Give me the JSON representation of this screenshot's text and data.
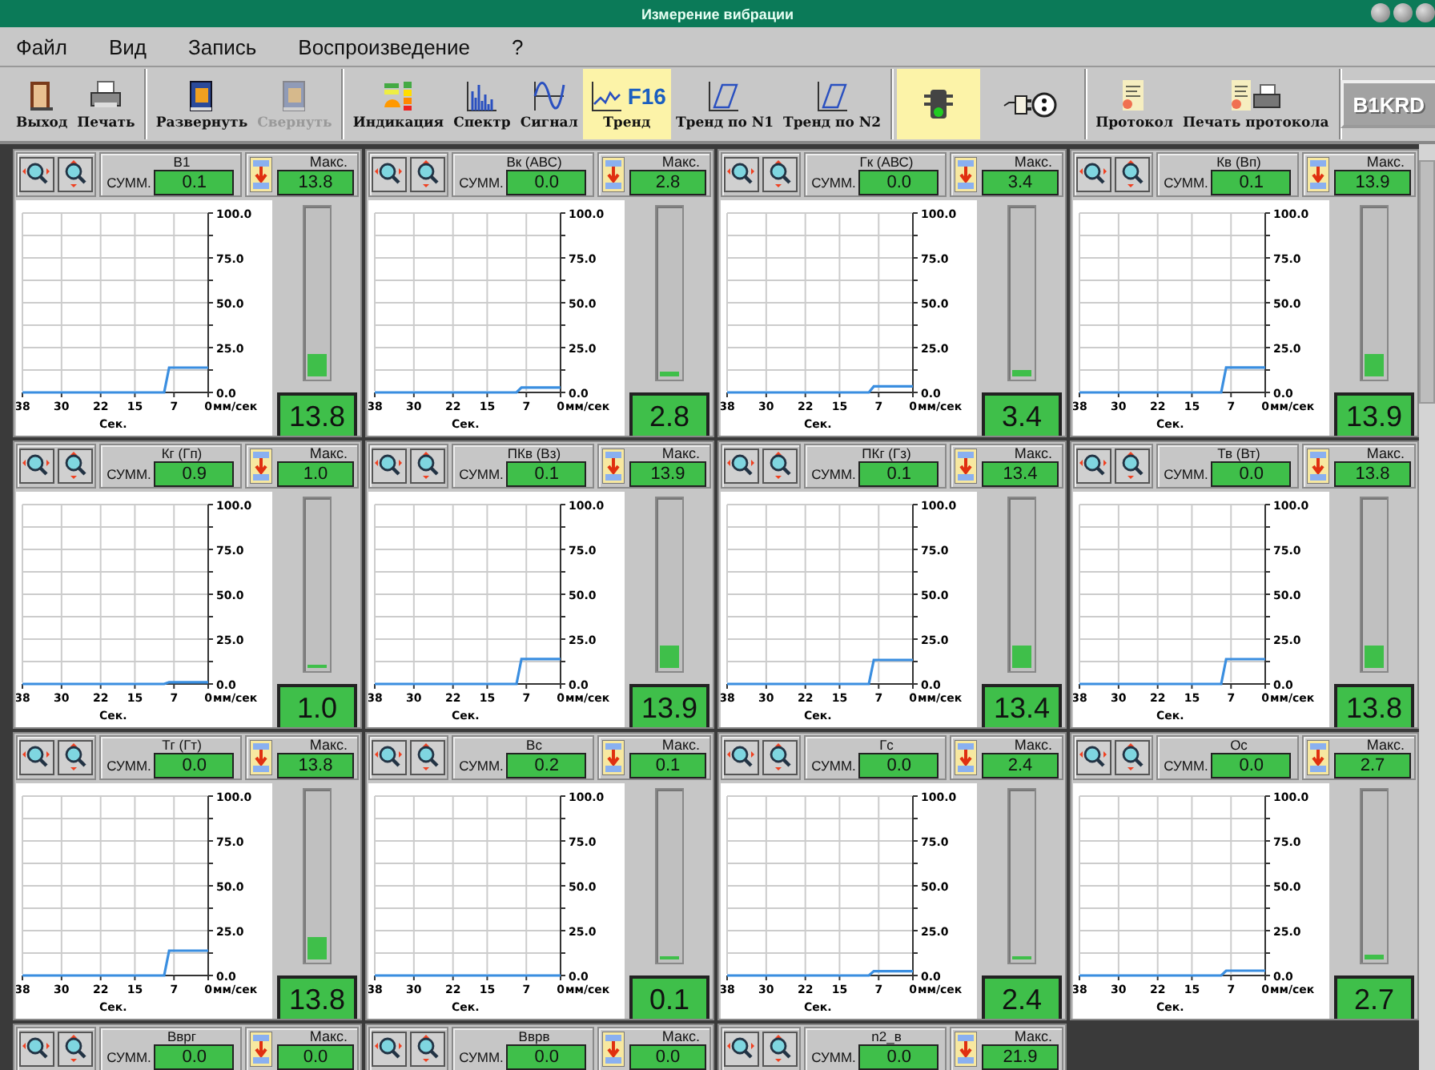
{
  "window": {
    "title": "Измерение вибрации"
  },
  "menu": [
    "Файл",
    "Вид",
    "Запись",
    "Воспроизведение",
    "?"
  ],
  "toolbar": [
    [
      {
        "label": "Выход",
        "selected": false,
        "disabled": false
      },
      {
        "label": "Печать",
        "selected": false,
        "disabled": false
      }
    ],
    [
      {
        "label": "Развернуть",
        "selected": false,
        "disabled": false
      },
      {
        "label": "Свернуть",
        "selected": false,
        "disabled": true
      }
    ],
    [
      {
        "label": "Индикация",
        "selected": false,
        "disabled": false
      },
      {
        "label": "Спектр",
        "selected": false,
        "disabled": false
      },
      {
        "label": "Сигнал",
        "selected": false,
        "disabled": false
      },
      {
        "label": "Тренд",
        "badge": "F16",
        "selected": true,
        "disabled": false
      },
      {
        "label": "Тренд по N1",
        "selected": false,
        "disabled": false
      },
      {
        "label": "Тренд по N2",
        "selected": false,
        "disabled": false
      }
    ],
    [
      {
        "selected": true,
        "disabled": false
      },
      {
        "selected": false,
        "disabled": false
      }
    ],
    [
      {
        "label": "Протокол",
        "selected": false,
        "disabled": false
      },
      {
        "label": "Печать протокола",
        "selected": false,
        "disabled": false
      }
    ]
  ],
  "device_button": {
    "label": "B1KRD",
    "disabled": true
  },
  "panels": [
    {
      "kind": "full",
      "name": "B1",
      "summ_label": "СУММ.",
      "summ": "0.1",
      "max_label": "Макс.",
      "max": "13.8",
      "value": "13.8",
      "level": 0.138,
      "chart_data": {
        "type": "line",
        "grid": true,
        "xlabel": "Сек.",
        "ylabel": "мм/сек",
        "x": [
          38,
          9,
          8,
          0
        ],
        "series": [
          {
            "color": "#3a8ee0",
            "values": [
              0,
              0,
              13.8,
              13.8
            ]
          }
        ],
        "xlim": [
          38,
          0
        ],
        "ylim": [
          0,
          100
        ],
        "xticks": [
          38,
          30,
          22,
          15,
          7,
          0
        ],
        "yticks": [
          {
            "value": 0,
            "label": "0.0"
          },
          {
            "value": 25,
            "label": "25.0"
          },
          {
            "value": 50,
            "label": "50.0"
          },
          {
            "value": 75,
            "label": "75.0"
          },
          {
            "value": 100,
            "label": "100.0"
          }
        ]
      }
    },
    {
      "kind": "full",
      "name": "Вк (АВС)",
      "summ_label": "СУММ.",
      "summ": "0.0",
      "max_label": "Макс.",
      "max": "2.8",
      "value": "2.8",
      "level": 0.028,
      "chart_data": {
        "type": "line",
        "grid": true,
        "xlabel": "Сек.",
        "ylabel": "мм/сек",
        "x": [
          38,
          9,
          8,
          0
        ],
        "series": [
          {
            "color": "#3a8ee0",
            "values": [
              0,
              0,
              2.8,
              2.8
            ]
          }
        ],
        "xlim": [
          38,
          0
        ],
        "ylim": [
          0,
          100
        ],
        "xticks": [
          38,
          30,
          22,
          15,
          7,
          0
        ],
        "yticks": [
          {
            "value": 0,
            "label": "0.0"
          },
          {
            "value": 25,
            "label": "25.0"
          },
          {
            "value": 50,
            "label": "50.0"
          },
          {
            "value": 75,
            "label": "75.0"
          },
          {
            "value": 100,
            "label": "100.0"
          }
        ]
      }
    },
    {
      "kind": "full",
      "name": "Гк (АВС)",
      "summ_label": "СУММ.",
      "summ": "0.0",
      "max_label": "Макс.",
      "max": "3.4",
      "value": "3.4",
      "level": 0.034,
      "chart_data": {
        "type": "line",
        "grid": true,
        "xlabel": "Сек.",
        "ylabel": "мм/сек",
        "x": [
          38,
          9,
          8,
          0
        ],
        "series": [
          {
            "color": "#3a8ee0",
            "values": [
              0,
              0,
              3.4,
              3.4
            ]
          }
        ],
        "xlim": [
          38,
          0
        ],
        "ylim": [
          0,
          100
        ],
        "xticks": [
          38,
          30,
          22,
          15,
          7,
          0
        ],
        "yticks": [
          {
            "value": 0,
            "label": "0.0"
          },
          {
            "value": 25,
            "label": "25.0"
          },
          {
            "value": 50,
            "label": "50.0"
          },
          {
            "value": 75,
            "label": "75.0"
          },
          {
            "value": 100,
            "label": "100.0"
          }
        ]
      }
    },
    {
      "kind": "full",
      "name": "Кв (Вп)",
      "summ_label": "СУММ.",
      "summ": "0.1",
      "max_label": "Макс.",
      "max": "13.9",
      "value": "13.9",
      "level": 0.139,
      "chart_data": {
        "type": "line",
        "grid": true,
        "xlabel": "Сек.",
        "ylabel": "мм/сек",
        "x": [
          38,
          9,
          8,
          0
        ],
        "series": [
          {
            "color": "#3a8ee0",
            "values": [
              0,
              0,
              13.9,
              13.9
            ]
          }
        ],
        "xlim": [
          38,
          0
        ],
        "ylim": [
          0,
          100
        ],
        "xticks": [
          38,
          30,
          22,
          15,
          7,
          0
        ],
        "yticks": [
          {
            "value": 0,
            "label": "0.0"
          },
          {
            "value": 25,
            "label": "25.0"
          },
          {
            "value": 50,
            "label": "50.0"
          },
          {
            "value": 75,
            "label": "75.0"
          },
          {
            "value": 100,
            "label": "100.0"
          }
        ]
      }
    },
    {
      "kind": "full",
      "name": "Кг (Гп)",
      "summ_label": "СУММ.",
      "summ": "0.9",
      "max_label": "Макс.",
      "max": "1.0",
      "value": "1.0",
      "level": 0.01,
      "chart_data": {
        "type": "line",
        "grid": true,
        "xlabel": "Сек.",
        "ylabel": "мм/сек",
        "x": [
          38,
          9,
          8,
          0
        ],
        "series": [
          {
            "color": "#3a8ee0",
            "values": [
              0,
              0,
              1.0,
              1.0
            ]
          }
        ],
        "xlim": [
          38,
          0
        ],
        "ylim": [
          0,
          100
        ],
        "xticks": [
          38,
          30,
          22,
          15,
          7,
          0
        ],
        "yticks": [
          {
            "value": 0,
            "label": "0.0"
          },
          {
            "value": 25,
            "label": "25.0"
          },
          {
            "value": 50,
            "label": "50.0"
          },
          {
            "value": 75,
            "label": "75.0"
          },
          {
            "value": 100,
            "label": "100.0"
          }
        ]
      }
    },
    {
      "kind": "full",
      "name": "ПКв (Вз)",
      "summ_label": "СУММ.",
      "summ": "0.1",
      "max_label": "Макс.",
      "max": "13.9",
      "value": "13.9",
      "level": 0.139,
      "chart_data": {
        "type": "line",
        "grid": true,
        "xlabel": "Сек.",
        "ylabel": "мм/сек",
        "x": [
          38,
          9,
          8,
          0
        ],
        "series": [
          {
            "color": "#3a8ee0",
            "values": [
              0,
              0,
              13.9,
              13.9
            ]
          }
        ],
        "xlim": [
          38,
          0
        ],
        "ylim": [
          0,
          100
        ],
        "xticks": [
          38,
          30,
          22,
          15,
          7,
          0
        ],
        "yticks": [
          {
            "value": 0,
            "label": "0.0"
          },
          {
            "value": 25,
            "label": "25.0"
          },
          {
            "value": 50,
            "label": "50.0"
          },
          {
            "value": 75,
            "label": "75.0"
          },
          {
            "value": 100,
            "label": "100.0"
          }
        ]
      }
    },
    {
      "kind": "full",
      "name": "ПКг (Гз)",
      "summ_label": "СУММ.",
      "summ": "0.1",
      "max_label": "Макс.",
      "max": "13.4",
      "value": "13.4",
      "level": 0.134,
      "chart_data": {
        "type": "line",
        "grid": true,
        "xlabel": "Сек.",
        "ylabel": "мм/сек",
        "x": [
          38,
          9,
          8,
          0
        ],
        "series": [
          {
            "color": "#3a8ee0",
            "values": [
              0,
              0,
              13.4,
              13.4
            ]
          }
        ],
        "xlim": [
          38,
          0
        ],
        "ylim": [
          0,
          100
        ],
        "xticks": [
          38,
          30,
          22,
          15,
          7,
          0
        ],
        "yticks": [
          {
            "value": 0,
            "label": "0.0"
          },
          {
            "value": 25,
            "label": "25.0"
          },
          {
            "value": 50,
            "label": "50.0"
          },
          {
            "value": 75,
            "label": "75.0"
          },
          {
            "value": 100,
            "label": "100.0"
          }
        ]
      }
    },
    {
      "kind": "full",
      "name": "Тв (Вт)",
      "summ_label": "СУММ.",
      "summ": "0.0",
      "max_label": "Макс.",
      "max": "13.8",
      "value": "13.8",
      "level": 0.138,
      "chart_data": {
        "type": "line",
        "grid": true,
        "xlabel": "Сек.",
        "ylabel": "мм/сек",
        "x": [
          38,
          9,
          8,
          0
        ],
        "series": [
          {
            "color": "#3a8ee0",
            "values": [
              0,
              0,
              13.8,
              13.8
            ]
          }
        ],
        "xlim": [
          38,
          0
        ],
        "ylim": [
          0,
          100
        ],
        "xticks": [
          38,
          30,
          22,
          15,
          7,
          0
        ],
        "yticks": [
          {
            "value": 0,
            "label": "0.0"
          },
          {
            "value": 25,
            "label": "25.0"
          },
          {
            "value": 50,
            "label": "50.0"
          },
          {
            "value": 75,
            "label": "75.0"
          },
          {
            "value": 100,
            "label": "100.0"
          }
        ]
      }
    },
    {
      "kind": "full",
      "name": "Тг (Гт)",
      "summ_label": "СУММ.",
      "summ": "0.0",
      "max_label": "Макс.",
      "max": "13.8",
      "value": "13.8",
      "level": 0.138,
      "chart_data": {
        "type": "line",
        "grid": true,
        "xlabel": "Сек.",
        "ylabel": "мм/сек",
        "x": [
          38,
          9,
          8,
          0
        ],
        "series": [
          {
            "color": "#3a8ee0",
            "values": [
              0,
              0,
              13.8,
              13.8
            ]
          }
        ],
        "xlim": [
          38,
          0
        ],
        "ylim": [
          0,
          100
        ],
        "xticks": [
          38,
          30,
          22,
          15,
          7,
          0
        ],
        "yticks": [
          {
            "value": 0,
            "label": "0.0"
          },
          {
            "value": 25,
            "label": "25.0"
          },
          {
            "value": 50,
            "label": "50.0"
          },
          {
            "value": 75,
            "label": "75.0"
          },
          {
            "value": 100,
            "label": "100.0"
          }
        ]
      }
    },
    {
      "kind": "full",
      "name": "Вс",
      "summ_label": "СУММ.",
      "summ": "0.2",
      "max_label": "Макс.",
      "max": "0.1",
      "value": "0.1",
      "level": 0.001,
      "chart_data": {
        "type": "line",
        "grid": true,
        "xlabel": "Сек.",
        "ylabel": "мм/сек",
        "x": [
          38,
          0
        ],
        "series": [
          {
            "color": "#3a8ee0",
            "values": [
              0,
              0
            ]
          }
        ],
        "xlim": [
          38,
          0
        ],
        "ylim": [
          0,
          100
        ],
        "xticks": [
          38,
          30,
          22,
          15,
          7,
          0
        ],
        "yticks": [
          {
            "value": 0,
            "label": "0.0"
          },
          {
            "value": 25,
            "label": "25.0"
          },
          {
            "value": 50,
            "label": "50.0"
          },
          {
            "value": 75,
            "label": "75.0"
          },
          {
            "value": 100,
            "label": "100.0"
          }
        ]
      }
    },
    {
      "kind": "full",
      "name": "Гс",
      "summ_label": "СУММ.",
      "summ": "0.0",
      "max_label": "Макс.",
      "max": "2.4",
      "value": "2.4",
      "level": 0.024,
      "chart_data": {
        "type": "line",
        "grid": true,
        "xlabel": "Сек.",
        "ylabel": "мм/сек",
        "x": [
          38,
          9,
          8,
          0
        ],
        "series": [
          {
            "color": "#3a8ee0",
            "values": [
              0,
              0,
              2.4,
              2.4
            ]
          }
        ],
        "xlim": [
          38,
          0
        ],
        "ylim": [
          0,
          100
        ],
        "xticks": [
          38,
          30,
          22,
          15,
          7,
          0
        ],
        "yticks": [
          {
            "value": 0,
            "label": "0.0"
          },
          {
            "value": 25,
            "label": "25.0"
          },
          {
            "value": 50,
            "label": "50.0"
          },
          {
            "value": 75,
            "label": "75.0"
          },
          {
            "value": 100,
            "label": "100.0"
          }
        ]
      }
    },
    {
      "kind": "full",
      "name": "Ос",
      "summ_label": "СУММ.",
      "summ": "0.0",
      "max_label": "Макс.",
      "max": "2.7",
      "value": "2.7",
      "level": 0.027,
      "chart_data": {
        "type": "line",
        "grid": true,
        "xlabel": "Сек.",
        "ylabel": "мм/сек",
        "x": [
          38,
          9,
          8,
          0
        ],
        "series": [
          {
            "color": "#3a8ee0",
            "values": [
              0,
              0,
              2.7,
              2.7
            ]
          }
        ],
        "xlim": [
          38,
          0
        ],
        "ylim": [
          0,
          100
        ],
        "xticks": [
          38,
          30,
          22,
          15,
          7,
          0
        ],
        "yticks": [
          {
            "value": 0,
            "label": "0.0"
          },
          {
            "value": 25,
            "label": "25.0"
          },
          {
            "value": 50,
            "label": "50.0"
          },
          {
            "value": 75,
            "label": "75.0"
          },
          {
            "value": 100,
            "label": "100.0"
          }
        ]
      }
    },
    {
      "kind": "header",
      "name": "Вврг",
      "summ_label": "СУММ.",
      "summ": "0.0",
      "max_label": "Макс.",
      "max": "0.0"
    },
    {
      "kind": "header",
      "name": "Вврв",
      "summ_label": "СУММ.",
      "summ": "0.0",
      "max_label": "Макс.",
      "max": "0.0"
    },
    {
      "kind": "header",
      "name": "n2_в",
      "summ_label": "СУММ.",
      "summ": "0.0",
      "max_label": "Макс.",
      "max": "21.9"
    }
  ]
}
